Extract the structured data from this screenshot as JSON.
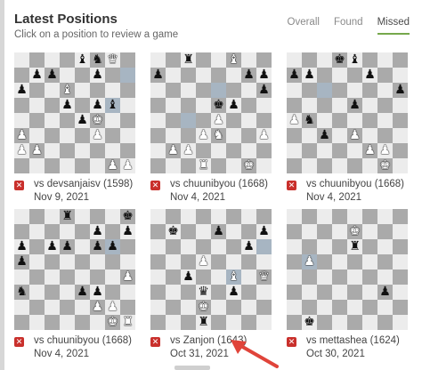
{
  "header": {
    "title": "Latest Positions",
    "subtitle": "Click on a position to review a game"
  },
  "tabs": [
    {
      "label": "Overall",
      "active": false
    },
    {
      "label": "Found",
      "active": false
    },
    {
      "label": "Missed",
      "active": true
    }
  ],
  "colors": {
    "accent_underline": "#76a84c",
    "missed_icon": "#c9302c",
    "light_square": "#ececec",
    "dark_square": "#aaaaaa",
    "highlight_square": "#a7b5c2",
    "arrow": "#e0443a"
  },
  "icons": {
    "missed": "x-icon",
    "annotation": "arrow-icon"
  },
  "games": [
    {
      "opponent": "vs devsanjaisv (1598)",
      "date": "Nov 9, 2021",
      "board": [
        "....bnQ.",
        ".pp..p..",
        "p..B....",
        "...p.pb.",
        "....pK..",
        "P....P..",
        "PP......",
        "......PP"
      ],
      "highlight": [
        [
          1,
          7
        ],
        [
          3,
          6
        ]
      ]
    },
    {
      "opponent": "vs chuunibyou (1668)",
      "date": "Nov 4, 2021",
      "board": [
        "..r..B..",
        "p.....pp",
        ".......p",
        "....kp..",
        "....P...",
        "...PN..P",
        ".PP.....",
        "...R..K."
      ],
      "highlight": [
        [
          2,
          4
        ],
        [
          4,
          2
        ]
      ]
    },
    {
      "opponent": "vs chuunibyou (1668)",
      "date": "Nov 4, 2021",
      "board": [
        "...kb...",
        "pp...p..",
        ".......p",
        "....p...",
        "Pn......",
        "..p.P...",
        ".....PP.",
        "......K."
      ],
      "highlight": [
        [
          2,
          2
        ]
      ]
    },
    {
      "opponent": "vs chuunibyou (1668)",
      "date": "Nov 4, 2021",
      "board": [
        "...r...k",
        ".....p.p",
        "p.pp.pp.",
        "p.......",
        ".......P",
        "n...pp..",
        ".....PP.",
        "......KR"
      ],
      "highlight": [
        [
          2,
          6
        ]
      ]
    },
    {
      "opponent": "vs Zanjon (1643)",
      "date": "Oct 31, 2021",
      "board": [
        "........",
        ".k..p..p",
        "......p.",
        "...P....",
        "..p..B.Q",
        "...q.p..",
        "...K....",
        "...r...."
      ],
      "highlight": [
        [
          4,
          5
        ],
        [
          2,
          7
        ]
      ]
    },
    {
      "opponent": "vs mettashea (1624)",
      "date": "Oct 30, 2021",
      "board": [
        "........",
        "....K...",
        "....r...",
        ".P......",
        "........",
        "......p.",
        "........",
        ".k......"
      ],
      "highlight": [
        [
          3,
          1
        ]
      ]
    }
  ]
}
